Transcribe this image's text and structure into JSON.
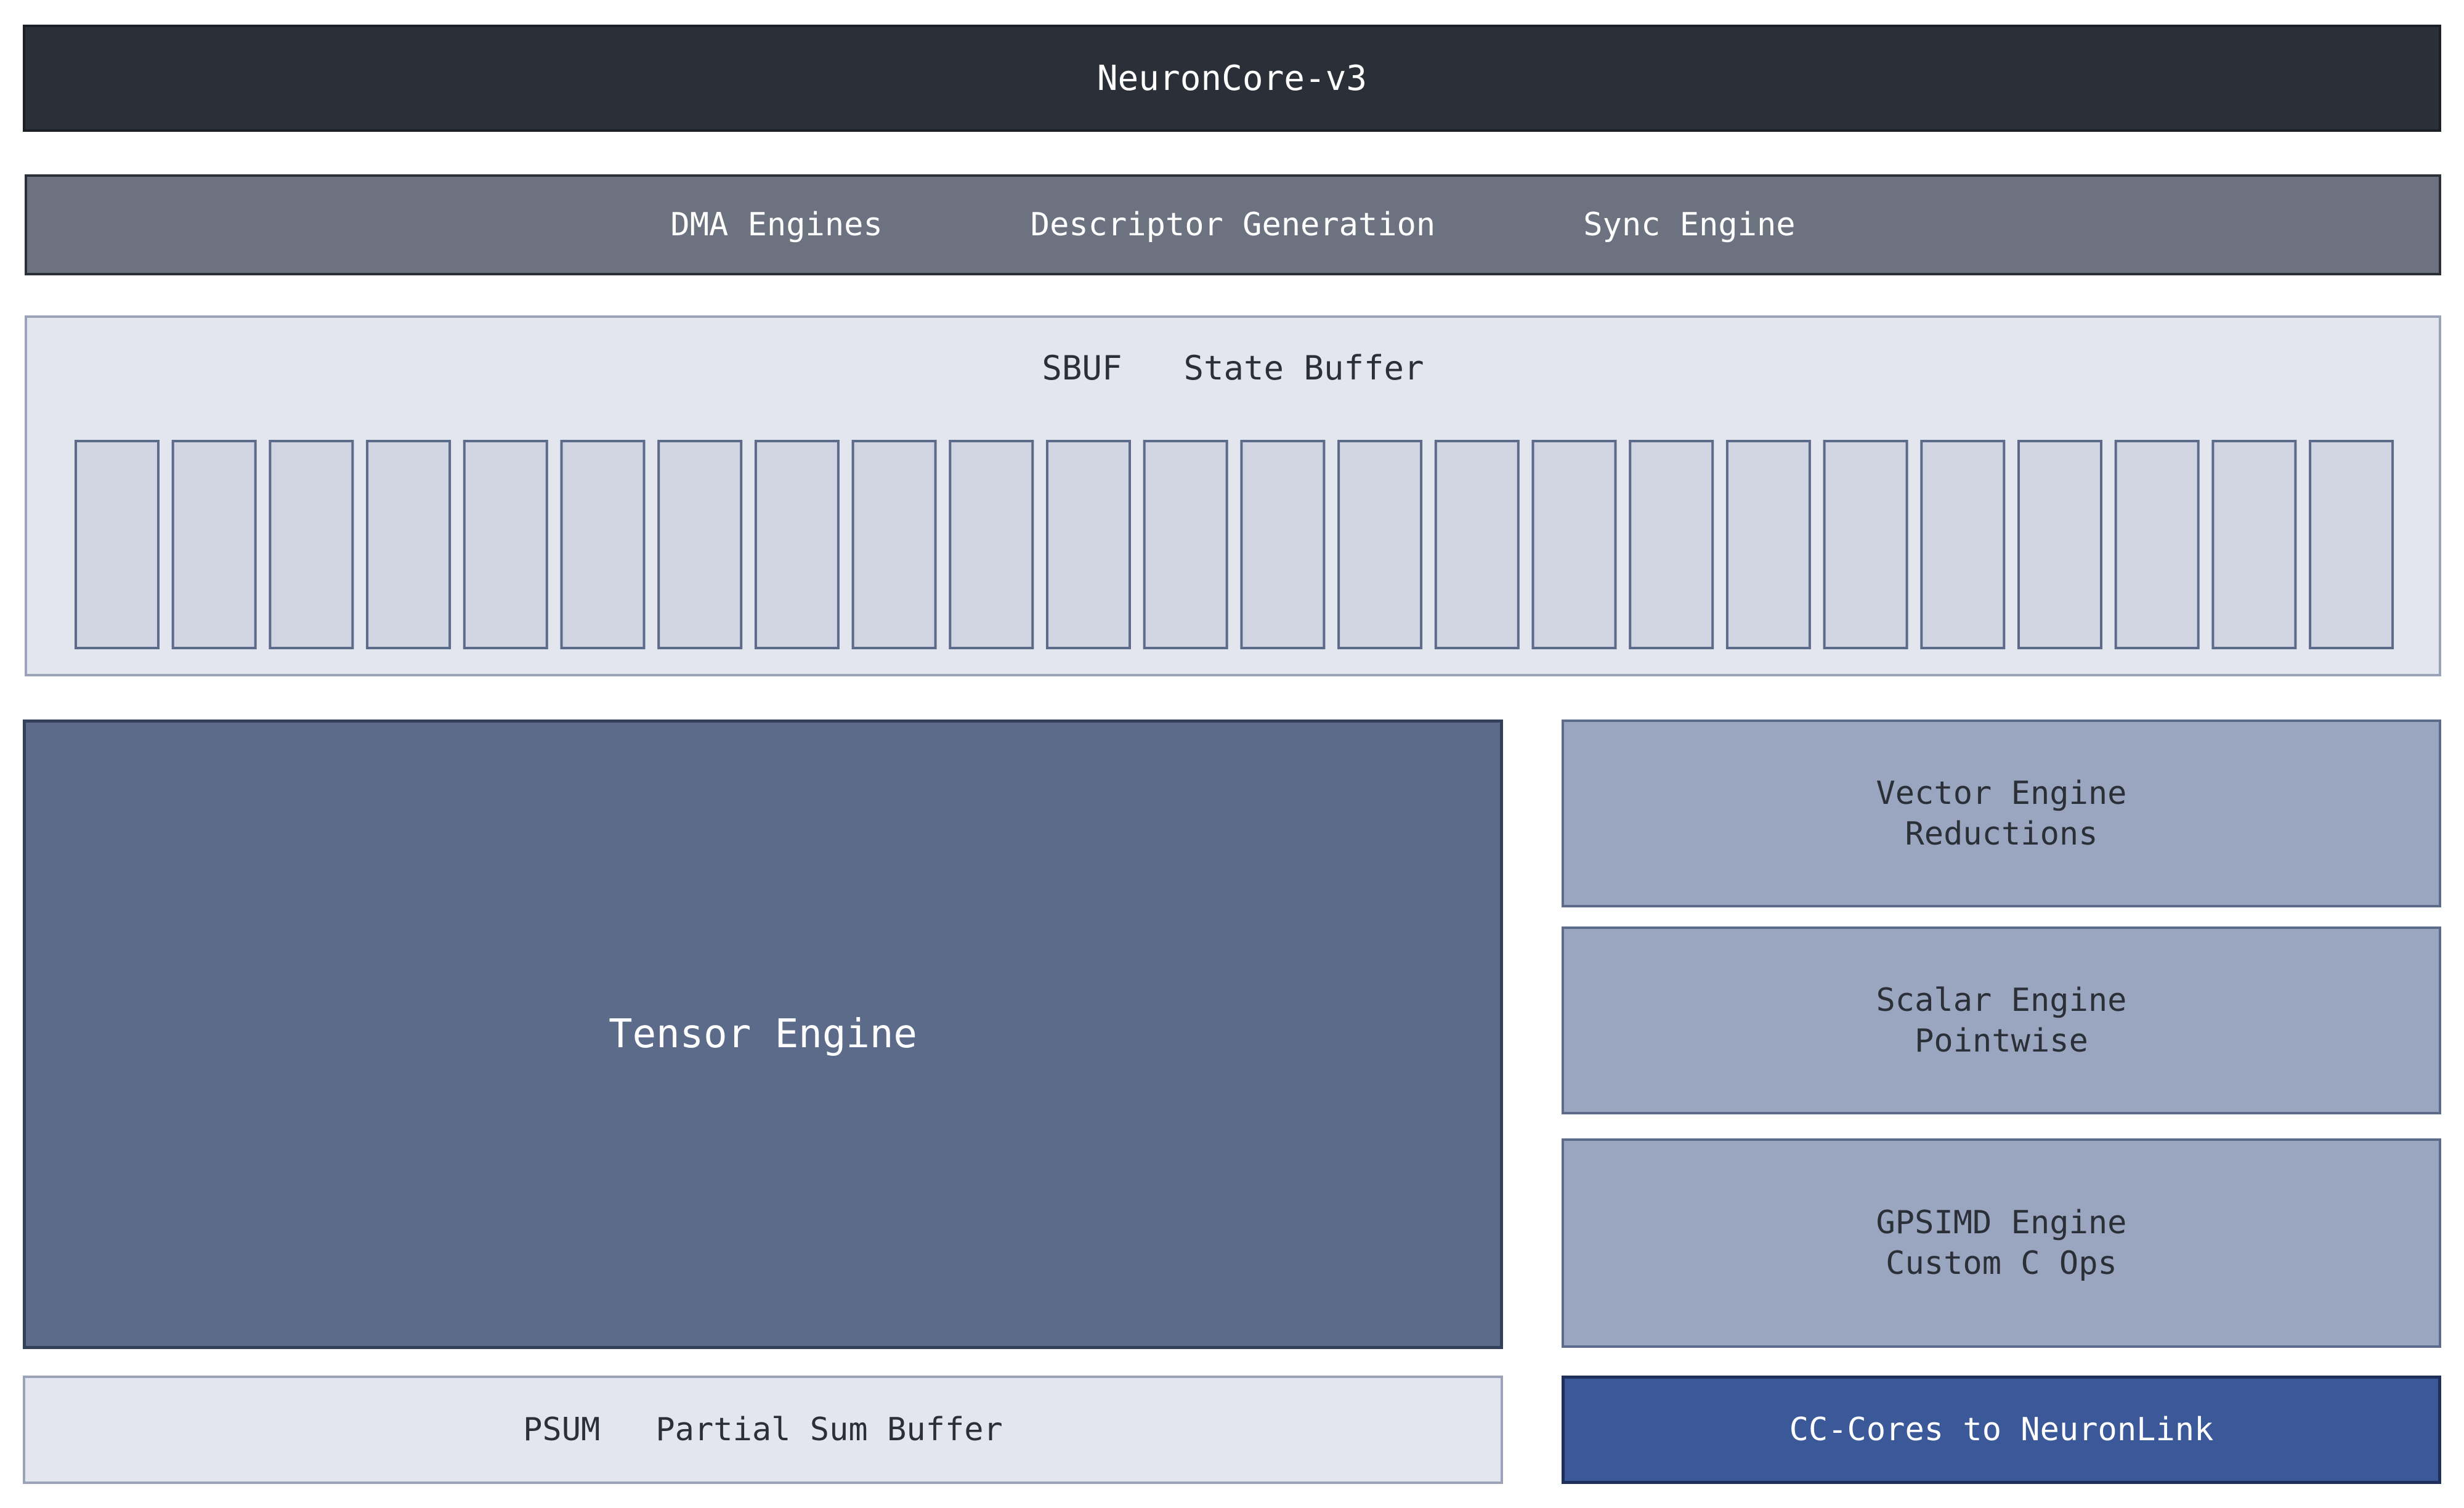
{
  "header": {
    "title": "NeuronCore-v3"
  },
  "dma_bar": {
    "items": [
      "DMA Engines",
      "Descriptor Generation",
      "Sync Engine"
    ]
  },
  "sbuf": {
    "abbr": "SBUF",
    "name": "State Buffer",
    "lane_count": 24
  },
  "tensor_engine": {
    "label": "Tensor Engine"
  },
  "vector_engine": {
    "line1": "Vector Engine",
    "line2": "Reductions"
  },
  "scalar_engine": {
    "line1": "Scalar Engine",
    "line2": "Pointwise"
  },
  "gpsimd_engine": {
    "line1": "GPSIMD Engine",
    "line2": "Custom C Ops"
  },
  "psum": {
    "abbr": "PSUM",
    "name": "Partial Sum Buffer"
  },
  "cc_cores": {
    "label": "CC-Cores to NeuronLink"
  },
  "colors": {
    "header": "#2b2f37",
    "dma_bar": "#6c7280",
    "buffer": "#e3e6ee",
    "lane": "#d0d5e1",
    "tensor": "#5b6b89",
    "side_engine": "#9aa5c0",
    "cc_cores": "#3b5998"
  }
}
